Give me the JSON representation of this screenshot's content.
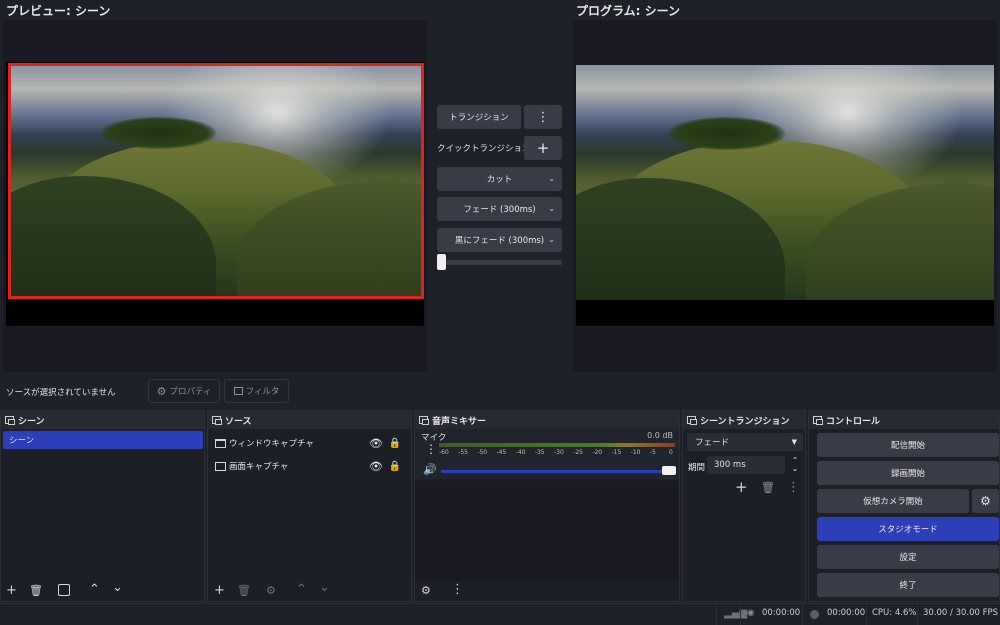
{
  "preview": {
    "label": "プレビュー: シーン"
  },
  "program": {
    "label": "プログラム: シーン"
  },
  "transitions": {
    "transition_button": "トランジション",
    "quick_label": "クイックトランジション",
    "quick_items": [
      "カット",
      "フェード (300ms)",
      "黒にフェード (300ms)"
    ],
    "tbar_value": 0
  },
  "source_toolbar": {
    "no_source": "ソースが選択されていません",
    "properties": "プロパティ",
    "filters": "フィルタ"
  },
  "scenes": {
    "title": "シーン",
    "items": [
      "シーン"
    ]
  },
  "sources": {
    "title": "ソース",
    "items": [
      "ウィンドウキャプチャ",
      "画面キャプチャ"
    ]
  },
  "mixer": {
    "title": "音声ミキサー",
    "channel": "マイク",
    "level": "0.0 dB",
    "scale": [
      "-60",
      "-55",
      "-50",
      "-45",
      "-40",
      "-35",
      "-30",
      "-25",
      "-20",
      "-15",
      "-10",
      "-5",
      "0"
    ],
    "volume_fraction": 1.0
  },
  "scene_transitions": {
    "title": "シーントランジション",
    "selected": "フェード",
    "duration_label": "期間",
    "duration_value": "300 ms"
  },
  "controls": {
    "title": "コントロール",
    "start_streaming": "配信開始",
    "start_recording": "録画開始",
    "start_virtualcam": "仮想カメラ開始",
    "studio_mode": "スタジオモード",
    "settings": "設定",
    "exit": "終了"
  },
  "status": {
    "stream_time": "00:00:00",
    "record_time": "00:00:00",
    "cpu": "CPU: 4.6%",
    "fps": "30.00 / 30.00 FPS"
  },
  "colors": {
    "accent": "#2b3fb8",
    "preview_border": "#e0231f",
    "background": "#1f2129",
    "button": "#393b47"
  }
}
